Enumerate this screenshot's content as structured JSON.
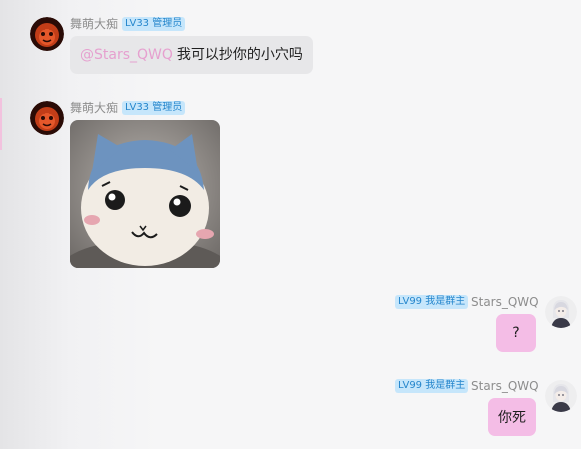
{
  "messages": [
    {
      "sender": "舞萌大痴",
      "badge": "LV33 管理员",
      "mention": "@Stars_QWQ",
      "text": "我可以抄你的小穴吗"
    },
    {
      "sender": "舞萌大痴",
      "badge": "LV33 管理员",
      "sticker": "chiikawa-hachiware-plush-sticker"
    },
    {
      "sender": "Stars_QWQ",
      "badge": "LV99 我是群主",
      "text": "?"
    },
    {
      "sender": "Stars_QWQ",
      "badge": "LV99 我是群主",
      "text": "你死"
    }
  ],
  "colors": {
    "badge_bg": "#c6e6fb",
    "badge_text": "#2586cc",
    "bubble_self": "#f4bde6",
    "bubble_other": "#e7e7e9",
    "mention": "#e6a0cf",
    "name": "#8d8d8d"
  }
}
